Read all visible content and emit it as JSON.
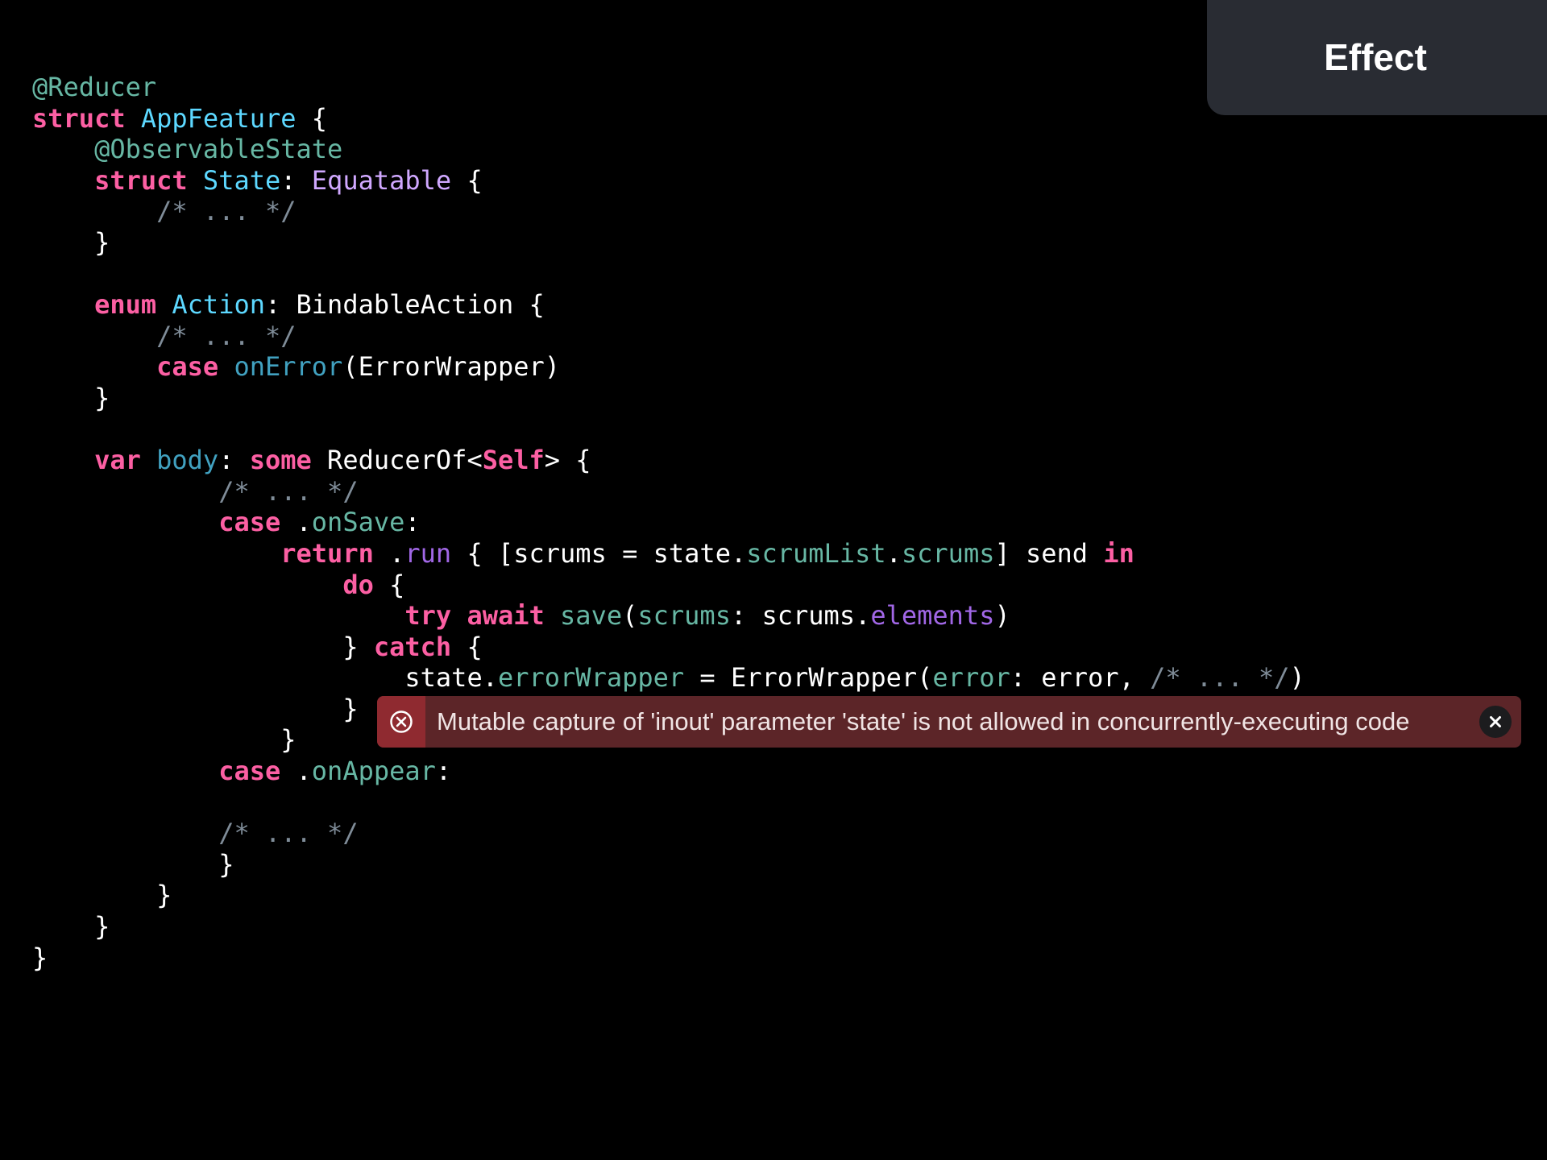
{
  "header": {
    "title": "Effect"
  },
  "code_lines": [
    [
      {
        "t": "@Reducer",
        "c": "attr"
      }
    ],
    [
      {
        "t": "struct",
        "c": "kw"
      },
      {
        "t": " ",
        "c": "plain"
      },
      {
        "t": "AppFeature",
        "c": "type"
      },
      {
        "t": " {",
        "c": "plain"
      }
    ],
    [
      {
        "t": "    ",
        "c": "plain"
      },
      {
        "t": "@ObservableState",
        "c": "attr"
      }
    ],
    [
      {
        "t": "    ",
        "c": "plain"
      },
      {
        "t": "struct",
        "c": "kw"
      },
      {
        "t": " ",
        "c": "plain"
      },
      {
        "t": "State",
        "c": "type"
      },
      {
        "t": ": ",
        "c": "plain"
      },
      {
        "t": "Equatable",
        "c": "proto"
      },
      {
        "t": " {",
        "c": "plain"
      }
    ],
    [
      {
        "t": "        ",
        "c": "plain"
      },
      {
        "t": "/* ... */",
        "c": "comment"
      }
    ],
    [
      {
        "t": "    }",
        "c": "plain"
      }
    ],
    [],
    [
      {
        "t": "    ",
        "c": "plain"
      },
      {
        "t": "enum",
        "c": "kw"
      },
      {
        "t": " ",
        "c": "plain"
      },
      {
        "t": "Action",
        "c": "type"
      },
      {
        "t": ": BindableAction {",
        "c": "plain"
      }
    ],
    [
      {
        "t": "        ",
        "c": "plain"
      },
      {
        "t": "/* ... */",
        "c": "comment"
      }
    ],
    [
      {
        "t": "        ",
        "c": "plain"
      },
      {
        "t": "case",
        "c": "kw"
      },
      {
        "t": " ",
        "c": "plain"
      },
      {
        "t": "onError",
        "c": "case"
      },
      {
        "t": "(ErrorWrapper)",
        "c": "plain"
      }
    ],
    [
      {
        "t": "    }",
        "c": "plain"
      }
    ],
    [],
    [
      {
        "t": "    ",
        "c": "plain"
      },
      {
        "t": "var",
        "c": "kw"
      },
      {
        "t": " ",
        "c": "plain"
      },
      {
        "t": "body",
        "c": "decl"
      },
      {
        "t": ": ",
        "c": "plain"
      },
      {
        "t": "some",
        "c": "kw"
      },
      {
        "t": " ReducerOf<",
        "c": "plain"
      },
      {
        "t": "Self",
        "c": "kw"
      },
      {
        "t": "> {",
        "c": "plain"
      }
    ],
    [
      {
        "t": "            ",
        "c": "plain"
      },
      {
        "t": "/* ... */",
        "c": "comment"
      }
    ],
    [
      {
        "t": "            ",
        "c": "plain"
      },
      {
        "t": "case",
        "c": "kw"
      },
      {
        "t": " .",
        "c": "plain"
      },
      {
        "t": "onSave",
        "c": "member"
      },
      {
        "t": ":",
        "c": "plain"
      }
    ],
    [
      {
        "t": "                ",
        "c": "plain"
      },
      {
        "t": "return",
        "c": "kw"
      },
      {
        "t": " .",
        "c": "plain"
      },
      {
        "t": "run",
        "c": "method"
      },
      {
        "t": " { [scrums = state.",
        "c": "plain"
      },
      {
        "t": "scrumList",
        "c": "prop"
      },
      {
        "t": ".",
        "c": "plain"
      },
      {
        "t": "scrums",
        "c": "prop"
      },
      {
        "t": "] send ",
        "c": "plain"
      },
      {
        "t": "in",
        "c": "kw"
      }
    ],
    [
      {
        "t": "                    ",
        "c": "plain"
      },
      {
        "t": "do",
        "c": "kw"
      },
      {
        "t": " {",
        "c": "plain"
      }
    ],
    [
      {
        "t": "                        ",
        "c": "plain"
      },
      {
        "t": "try",
        "c": "kw"
      },
      {
        "t": " ",
        "c": "plain"
      },
      {
        "t": "await",
        "c": "kw"
      },
      {
        "t": " ",
        "c": "plain"
      },
      {
        "t": "save",
        "c": "call"
      },
      {
        "t": "(",
        "c": "plain"
      },
      {
        "t": "scrums",
        "c": "call"
      },
      {
        "t": ": scrums.",
        "c": "plain"
      },
      {
        "t": "elements",
        "c": "method"
      },
      {
        "t": ")",
        "c": "plain"
      }
    ],
    [
      {
        "t": "                    } ",
        "c": "plain"
      },
      {
        "t": "catch",
        "c": "kw"
      },
      {
        "t": " {",
        "c": "plain"
      }
    ],
    [
      {
        "t": "                        state.",
        "c": "plain"
      },
      {
        "t": "errorWrapper",
        "c": "prop"
      },
      {
        "t": " = ErrorWrapper(",
        "c": "plain"
      },
      {
        "t": "error",
        "c": "call"
      },
      {
        "t": ": error, ",
        "c": "plain"
      },
      {
        "t": "/* ... */",
        "c": "comment"
      },
      {
        "t": ")",
        "c": "plain"
      }
    ],
    [
      {
        "t": "                    }",
        "c": "plain"
      }
    ],
    [
      {
        "t": "                }",
        "c": "plain"
      }
    ],
    [
      {
        "t": "            ",
        "c": "plain"
      },
      {
        "t": "case",
        "c": "kw"
      },
      {
        "t": " .",
        "c": "plain"
      },
      {
        "t": "onAppear",
        "c": "member"
      },
      {
        "t": ":",
        "c": "plain"
      }
    ],
    [],
    [
      {
        "t": "            ",
        "c": "plain"
      },
      {
        "t": "/* ... */",
        "c": "comment"
      }
    ],
    [
      {
        "t": "            }",
        "c": "plain"
      }
    ],
    [
      {
        "t": "        }",
        "c": "plain"
      }
    ],
    [
      {
        "t": "    }",
        "c": "plain"
      }
    ],
    [
      {
        "t": "}",
        "c": "plain"
      }
    ]
  ],
  "error": {
    "message": "Mutable capture of 'inout' parameter 'state' is not allowed in concurrently-executing code",
    "icon": "error-x-circle-icon",
    "close_icon": "close-icon"
  },
  "colors": {
    "background": "#000000",
    "tab_background": "#292c33",
    "keyword": "#fc5fa3",
    "type": "#5dd8ff",
    "comment": "#7f8c98",
    "error_banner": "#5c2528",
    "error_icon_bg": "#8f2a30"
  }
}
